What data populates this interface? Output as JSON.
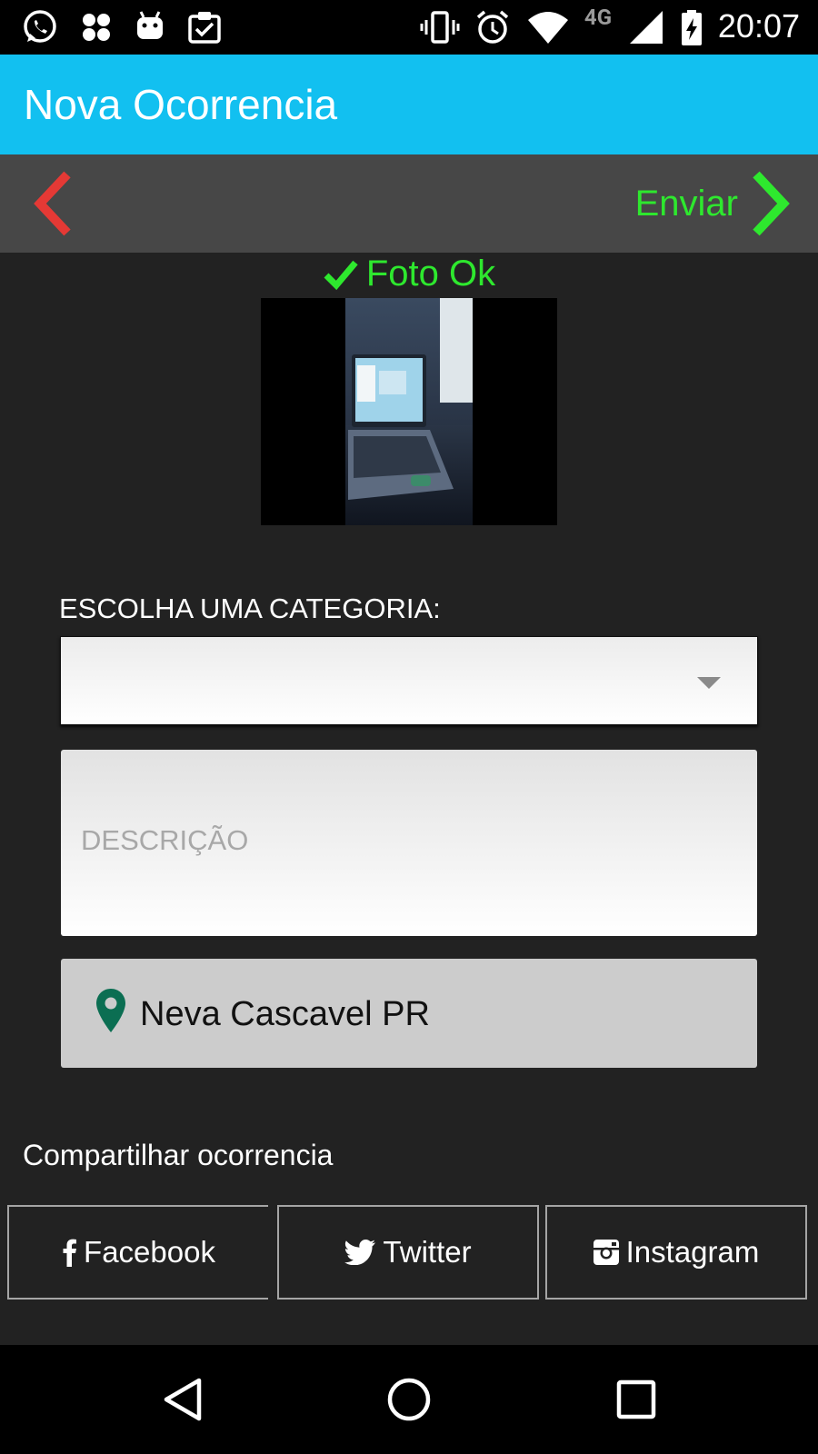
{
  "status_bar": {
    "time": "20:07",
    "network": "4G",
    "icons": [
      "whatsapp-icon",
      "pinwheel-icon",
      "android-icon",
      "clipboard-check-icon",
      "vibrate-icon",
      "alarm-icon",
      "wifi-icon",
      "signal-icon",
      "battery-charging-icon"
    ]
  },
  "app_bar": {
    "title": "Nova Ocorrencia"
  },
  "nav": {
    "send_label": "Enviar"
  },
  "photo": {
    "status_label": "Foto Ok"
  },
  "form": {
    "category_label": "ESCOLHA UMA CATEGORIA:",
    "category_value": "",
    "description_placeholder": "DESCRIÇÃO",
    "description_value": "",
    "location": "Neva Cascavel PR"
  },
  "share": {
    "label": "Compartilhar ocorrencia",
    "facebook": "Facebook",
    "twitter": "Twitter",
    "instagram": "Instagram"
  },
  "colors": {
    "app_bar": "#12c0f0",
    "nav_bar": "#474747",
    "background": "#222222",
    "accent_green": "#2ee82e",
    "back_red": "#e53935",
    "pin_green": "#0b6e52"
  }
}
